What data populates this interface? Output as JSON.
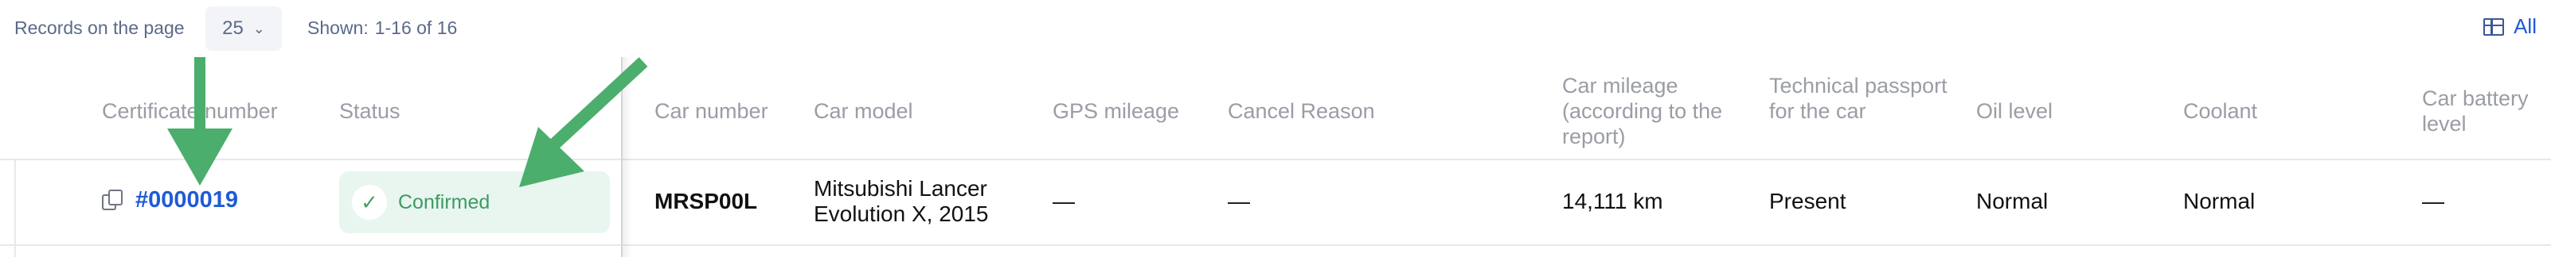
{
  "topbar": {
    "records_label": "Records on the page",
    "page_size_value": "25",
    "shown_label": "Shown:",
    "shown_value": "1-16 of 16",
    "all_label": "All"
  },
  "columns": [
    "Certificate number",
    "Status",
    "Car number",
    "Car model",
    "GPS mileage",
    "Cancel Reason",
    "Car mileage (according to the report)",
    "Technical passport for the car",
    "Oil level",
    "Coolant",
    "Car battery level"
  ],
  "row": {
    "certificate_number": "#0000019",
    "status": "Confirmed",
    "car_number": "MRSP00L",
    "car_model": "Mitsubishi Lancer Evolution X, 2015",
    "gps_mileage": "—",
    "cancel_reason": "—",
    "car_mileage": "14,111 km",
    "technical_passport": "Present",
    "oil_level": "Normal",
    "coolant": "Normal",
    "battery_level": "—"
  },
  "colors": {
    "accent": "#1f5bd6",
    "status_bg": "#e8f6ef",
    "status_text": "#3e9a64",
    "annotation_arrow": "#4cae6c"
  },
  "icons": [
    "chevron-down-icon",
    "grid-icon",
    "copy-icon",
    "check-icon",
    "arrow-annotation-icon"
  ]
}
